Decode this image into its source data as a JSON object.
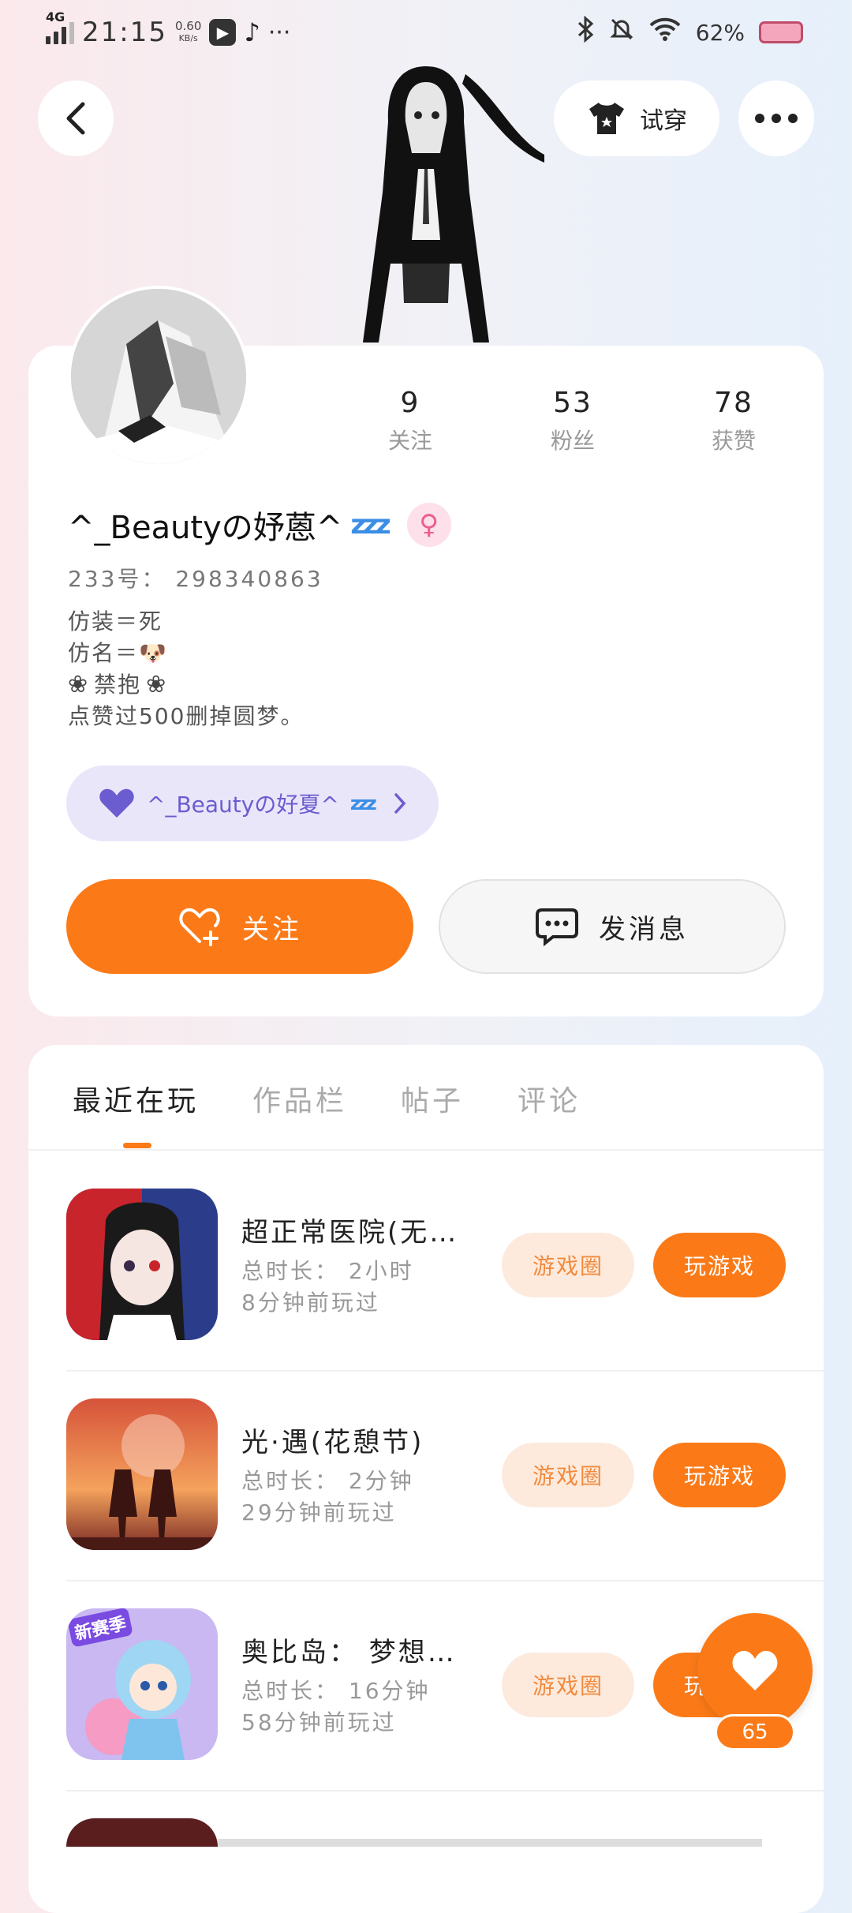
{
  "status_bar": {
    "network": "4G",
    "time": "21:15",
    "speed_value": "0.60",
    "speed_unit": "KB/s",
    "battery": "62%"
  },
  "top": {
    "try_on_label": "试穿"
  },
  "profile": {
    "stats": [
      {
        "value": "9",
        "label": "关注"
      },
      {
        "value": "53",
        "label": "粉丝"
      },
      {
        "value": "78",
        "label": "获赞"
      }
    ],
    "username": "^_Beautyの妤蒽^",
    "zzz": "zzz",
    "id_line": "233号： 298340863",
    "bio": [
      "仿装＝死",
      "仿名＝🐶",
      "禁抱",
      "点赞过500删掉圆梦。"
    ],
    "fan_badge_text": "^_Beautyの好夏^",
    "follow_label": "关注",
    "message_label": "发消息"
  },
  "tabs": [
    {
      "label": "最近在玩",
      "active": true
    },
    {
      "label": "作品栏",
      "active": false
    },
    {
      "label": "帖子",
      "active": false
    },
    {
      "label": "评论",
      "active": false
    }
  ],
  "games": [
    {
      "title": "超正常医院(无…",
      "duration": "总时长： 2小时",
      "last_played": "8分钟前玩过",
      "circle_label": "游戏圈",
      "play_label": "玩游戏"
    },
    {
      "title": "光·遇(花憩节)",
      "duration": "总时长： 2分钟",
      "last_played": "29分钟前玩过",
      "circle_label": "游戏圈",
      "play_label": "玩游戏"
    },
    {
      "title": "奥比岛： 梦想…",
      "duration": "总时长： 16分钟",
      "last_played": "58分钟前玩过",
      "circle_label": "游戏圈",
      "play_label": "玩游戏",
      "badge": "新赛季"
    }
  ],
  "like_fab": {
    "count": "65"
  },
  "colors": {
    "accent": "#fb7a17",
    "accent_light": "#fdeadd",
    "fan_badge_bg": "#e9e6fa",
    "female": "#ec5e8c"
  }
}
